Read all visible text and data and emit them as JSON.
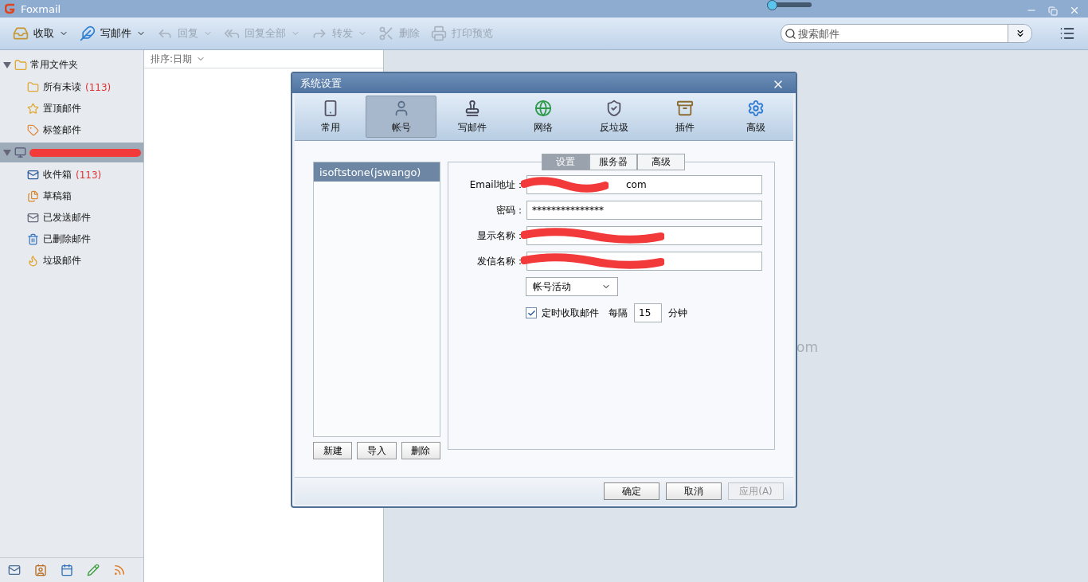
{
  "window": {
    "title": "Foxmail",
    "zoom_slider": {
      "level": 0.1
    }
  },
  "toolbar": {
    "buttons": [
      {
        "label": "收取",
        "disabled": false,
        "has_menu": true
      },
      {
        "label": "写邮件",
        "disabled": false,
        "has_menu": true
      },
      {
        "label": "回复",
        "disabled": true,
        "has_menu": true
      },
      {
        "label": "回复全部",
        "disabled": true,
        "has_menu": true
      },
      {
        "label": "转发",
        "disabled": true,
        "has_menu": true
      },
      {
        "label": "删除",
        "disabled": true,
        "has_menu": false
      },
      {
        "label": "打印预览",
        "disabled": true,
        "has_menu": false
      }
    ],
    "search": {
      "placeholder": "搜索邮件"
    }
  },
  "sidebar": {
    "groups": [
      {
        "label": "常用文件夹",
        "expanded": true,
        "selected": false,
        "items": [
          {
            "label": "所有未读",
            "count": "(113)"
          },
          {
            "label": "置顶邮件"
          },
          {
            "label": "标签邮件"
          }
        ]
      },
      {
        "expanded": true,
        "selected": true,
        "items": [
          {
            "label": "收件箱",
            "count": "(113)"
          },
          {
            "label": "草稿箱"
          },
          {
            "label": "已发送邮件"
          },
          {
            "label": "已删除邮件"
          },
          {
            "label": "垃圾邮件"
          }
        ]
      }
    ]
  },
  "message_list": {
    "sort": "排序:日期"
  },
  "reading_pane": {
    "text": "om"
  },
  "dialog": {
    "title": "系统设置",
    "tabs": [
      {
        "label": "常用",
        "selected": false
      },
      {
        "label": "帐号",
        "selected": true
      },
      {
        "label": "写邮件",
        "selected": false
      },
      {
        "label": "网络",
        "selected": false
      },
      {
        "label": "反垃圾",
        "selected": false
      },
      {
        "label": "插件",
        "selected": false
      },
      {
        "label": "高级",
        "selected": false
      }
    ],
    "accounts": [
      {
        "label": "isoftstone(jswango)",
        "selected": true
      }
    ],
    "account_buttons": [
      "新建",
      "导入",
      "删除"
    ],
    "subtabs": [
      {
        "label": "设置",
        "selected": true
      },
      {
        "label": "服务器",
        "selected": false
      },
      {
        "label": "高级",
        "selected": false
      }
    ],
    "fields": [
      {
        "label": "Email地址：",
        "value": "com",
        "kind": "scribbled"
      },
      {
        "label": "密码：",
        "value": "***************",
        "kind": "plain"
      },
      {
        "label": "显示名称：",
        "kind": "scribbled"
      },
      {
        "label": "发信名称：",
        "kind": "scribbled"
      }
    ],
    "status_select": "帐号活动",
    "auto_receive": {
      "label": "定时收取邮件",
      "checked": true,
      "every": "每隔",
      "interval": "15",
      "unit": "分钟"
    },
    "buttons": [
      {
        "label": "确定",
        "disabled": false
      },
      {
        "label": "取消",
        "disabled": false
      },
      {
        "label": "应用(A)",
        "disabled": true
      }
    ]
  }
}
